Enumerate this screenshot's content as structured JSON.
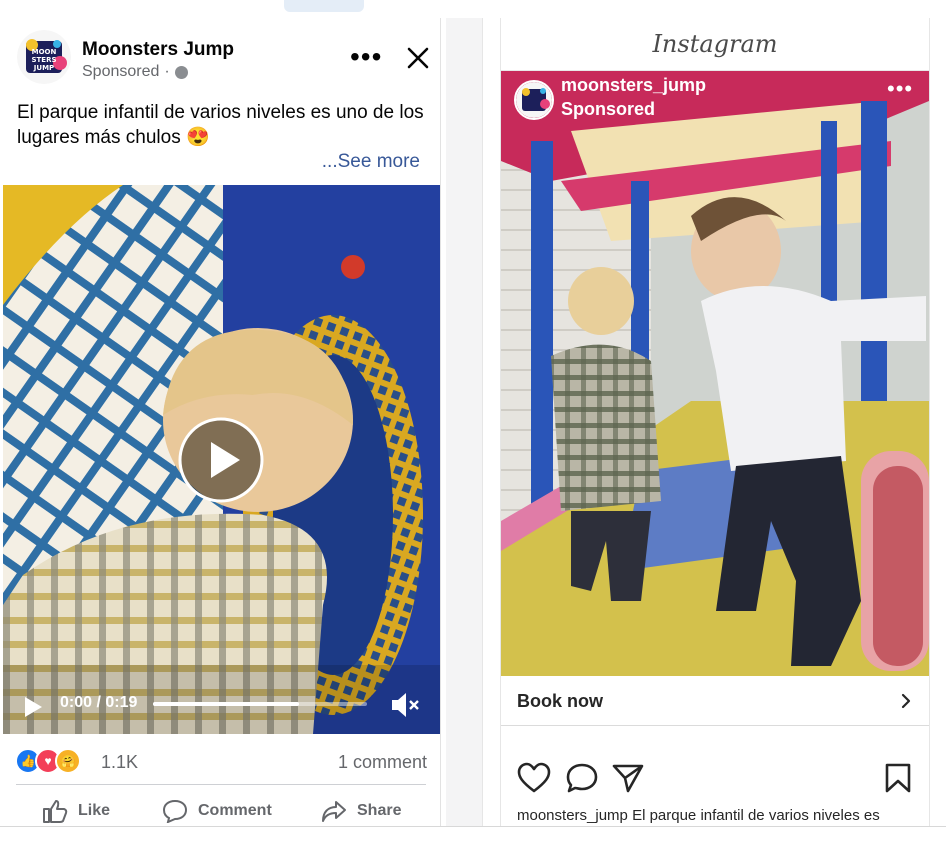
{
  "facebook": {
    "page_name": "Moonsters Jump",
    "sponsored": "Sponsored",
    "post_text": "El parque infantil de varios niveles es uno de los lugares más chulos 😍",
    "see_more": "...See more",
    "video": {
      "time": "0:00 / 0:19",
      "progress": 0.68
    },
    "reactions_count": "1.1K",
    "comments": "1 comment",
    "actions": {
      "like": "Like",
      "comment": "Comment",
      "share": "Share"
    }
  },
  "instagram": {
    "logo": "Instagram",
    "username": "moonsters_jump",
    "sponsored": "Sponsored",
    "cta": "Book now",
    "caption_user": "moonsters_jump",
    "caption_text": "El parque infantil de varios niveles es"
  },
  "colors": {
    "fb_link": "#385898",
    "fb_gray": "#65676b",
    "like_blue": "#1877f2",
    "love_red": "#f33e58"
  }
}
